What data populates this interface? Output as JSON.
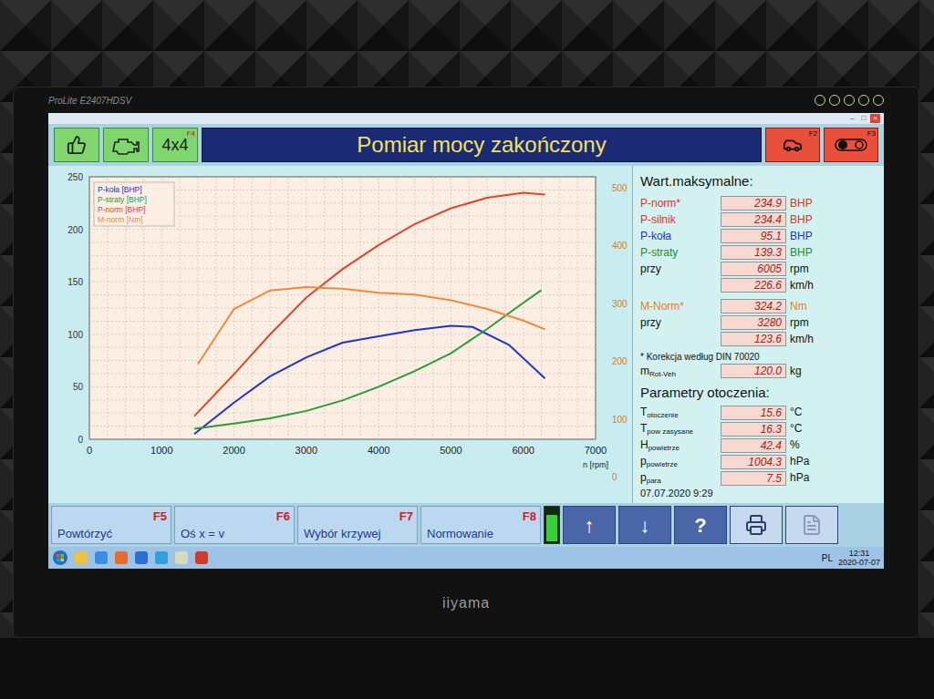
{
  "monitor": {
    "model": "ProLite E2407HDSV",
    "brand": "iiyama"
  },
  "window_controls": [
    "–",
    "□",
    "×"
  ],
  "toolbar": {
    "left": [
      {
        "kind": "thumb",
        "key": ""
      },
      {
        "kind": "engine",
        "key": ""
      },
      {
        "kind": "text",
        "label": "4x4",
        "key": "F4"
      }
    ],
    "right": [
      {
        "kind": "car",
        "key": "F2"
      },
      {
        "kind": "toggle",
        "key": "F3"
      }
    ]
  },
  "title": "Pomiar mocy zakończony",
  "chart": {
    "x_ticks": [
      "0",
      "1000",
      "2000",
      "3000",
      "4000",
      "5000",
      "6000",
      "7000"
    ],
    "x_label": "n [rpm]",
    "y_left_ticks": [
      "0",
      "50",
      "100",
      "150",
      "200",
      "250"
    ],
    "y_right_ticks": [
      "0",
      "100",
      "200",
      "300",
      "400",
      "500"
    ],
    "series": [
      {
        "name": "P-koła [BHP]",
        "color": "#2233cc",
        "axis": "left",
        "rpm": [
          1450,
          2000,
          2500,
          3000,
          3500,
          4000,
          4500,
          5000,
          5300,
          5800,
          6300
        ],
        "values": [
          5,
          35,
          60,
          78,
          92,
          98,
          104,
          108,
          107,
          90,
          58
        ]
      },
      {
        "name": "P-straty [BHP]",
        "color": "#2c9a3a",
        "axis": "left",
        "rpm": [
          1450,
          2000,
          2500,
          3000,
          3500,
          4000,
          4500,
          5000,
          5500,
          6000,
          6250
        ],
        "values": [
          10,
          15,
          20,
          27,
          37,
          50,
          65,
          82,
          105,
          130,
          142
        ]
      },
      {
        "name": "P-norm [BHP]",
        "color": "#e0442a",
        "axis": "left",
        "rpm": [
          1450,
          2000,
          2500,
          3000,
          3500,
          4000,
          4500,
          5000,
          5500,
          6000,
          6300
        ],
        "values": [
          22,
          62,
          100,
          135,
          162,
          185,
          205,
          220,
          230,
          234.9,
          233
        ]
      },
      {
        "name": "M-norm [Nm]",
        "color": "#f08a3a",
        "axis": "right",
        "rpm": [
          1500,
          2000,
          2500,
          3000,
          3300,
          3500,
          4000,
          4500,
          5000,
          5500,
          6000,
          6300
        ],
        "values": [
          195,
          290,
          322,
          328,
          326,
          325,
          318,
          315,
          305,
          290,
          270,
          255
        ]
      }
    ]
  },
  "max_values": {
    "title": "Wart.maksymalne:",
    "power": [
      {
        "label": "P-norm*",
        "value": "234.9",
        "unit": "BHP",
        "color": "#e0301e"
      },
      {
        "label": "P-silnik",
        "value": "234.4",
        "unit": "BHP",
        "color": "#e0301e"
      },
      {
        "label": "P-koła",
        "value": "95.1",
        "unit": "BHP",
        "color": "#1d2fd0"
      },
      {
        "label": "P-straty",
        "value": "139.3",
        "unit": "BHP",
        "color": "#1f8a30"
      },
      {
        "label": "przy",
        "value": "6005",
        "unit": "rpm",
        "color": "#111111"
      },
      {
        "label": "",
        "value": "226.6",
        "unit": "km/h",
        "color": "#111111"
      }
    ],
    "torque": [
      {
        "label": "M-Norm*",
        "value": "324.2",
        "unit": "Nm",
        "color": "#f07a28"
      },
      {
        "label": "przy",
        "value": "3280",
        "unit": "rpm",
        "color": "#111111"
      },
      {
        "label": "",
        "value": "123.6",
        "unit": "km/h",
        "color": "#111111"
      }
    ],
    "note": "* Korekcja według DIN 70020",
    "mass": {
      "label": "m",
      "sub": "Rot-Veh",
      "value": "120.0",
      "unit": "kg"
    }
  },
  "ambient": {
    "title": "Parametry otoczenia:",
    "rows": [
      {
        "label": "T",
        "sub": "otoczenie",
        "value": "15.6",
        "unit": "°C"
      },
      {
        "label": "T",
        "sub": "pow zasysane",
        "value": "16.3",
        "unit": "°C"
      },
      {
        "label": "H",
        "sub": "powietrze",
        "value": "42.4",
        "unit": "%"
      },
      {
        "label": "p",
        "sub": "powietrze",
        "value": "1004.3",
        "unit": "hPa"
      },
      {
        "label": "p",
        "sub": "para",
        "value": "7.5",
        "unit": "hPa"
      }
    ]
  },
  "timestamp": "07.07.2020 9:29",
  "function_keys": [
    {
      "label": "Powtórzyć",
      "key": "F5"
    },
    {
      "label": "Oś x = v",
      "key": "F6"
    },
    {
      "label": "Wybór krzywej",
      "key": "F7"
    },
    {
      "label": "Normowanie",
      "key": "F8"
    }
  ],
  "battery": {
    "level": 0.8
  },
  "nav_buttons": [
    {
      "kind": "text",
      "label": "↑"
    },
    {
      "kind": "text",
      "label": "↓"
    },
    {
      "kind": "text",
      "label": "?"
    },
    {
      "kind": "printer",
      "label": ""
    },
    {
      "kind": "document",
      "label": ""
    }
  ],
  "taskbar": {
    "language": "PL",
    "time": "12:31",
    "date": "2020-07-07"
  }
}
